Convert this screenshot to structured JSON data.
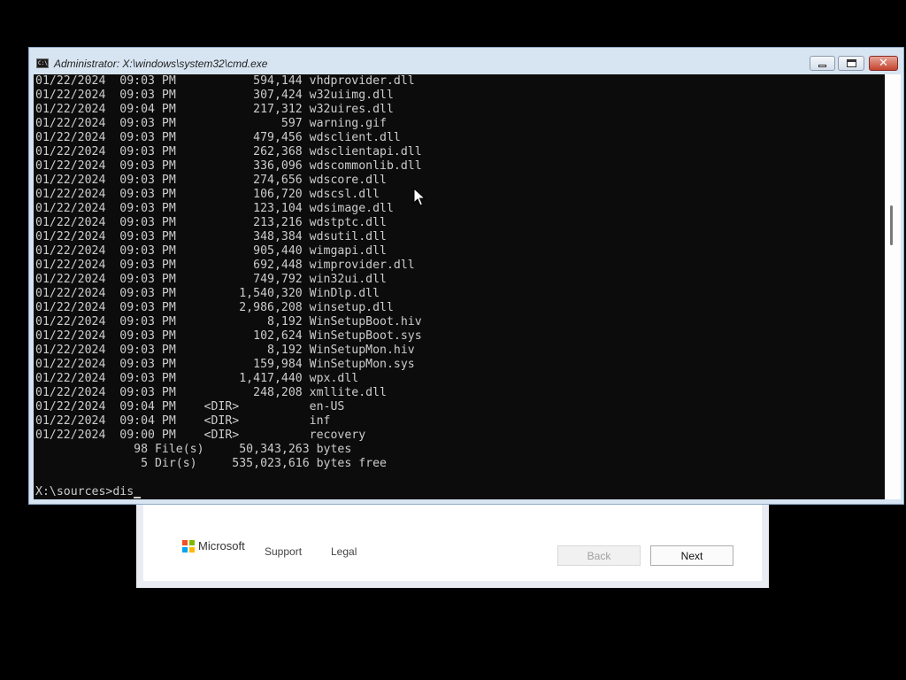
{
  "cmd_window": {
    "title": "Administrator: X:\\windows\\system32\\cmd.exe",
    "icon_text": "C:\\",
    "close_glyph": "✕"
  },
  "console": {
    "lines": [
      "01/22/2024  09:03 PM           594,144 vhdprovider.dll",
      "01/22/2024  09:03 PM           307,424 w32uiimg.dll",
      "01/22/2024  09:04 PM           217,312 w32uires.dll",
      "01/22/2024  09:03 PM               597 warning.gif",
      "01/22/2024  09:03 PM           479,456 wdsclient.dll",
      "01/22/2024  09:03 PM           262,368 wdsclientapi.dll",
      "01/22/2024  09:03 PM           336,096 wdscommonlib.dll",
      "01/22/2024  09:03 PM           274,656 wdscore.dll",
      "01/22/2024  09:03 PM           106,720 wdscsl.dll",
      "01/22/2024  09:03 PM           123,104 wdsimage.dll",
      "01/22/2024  09:03 PM           213,216 wdstptc.dll",
      "01/22/2024  09:03 PM           348,384 wdsutil.dll",
      "01/22/2024  09:03 PM           905,440 wimgapi.dll",
      "01/22/2024  09:03 PM           692,448 wimprovider.dll",
      "01/22/2024  09:03 PM           749,792 win32ui.dll",
      "01/22/2024  09:03 PM         1,540,320 WinDlp.dll",
      "01/22/2024  09:03 PM         2,986,208 winsetup.dll",
      "01/22/2024  09:03 PM             8,192 WinSetupBoot.hiv",
      "01/22/2024  09:03 PM           102,624 WinSetupBoot.sys",
      "01/22/2024  09:03 PM             8,192 WinSetupMon.hiv",
      "01/22/2024  09:03 PM           159,984 WinSetupMon.sys",
      "01/22/2024  09:03 PM         1,417,440 wpx.dll",
      "01/22/2024  09:03 PM           248,208 xmllite.dll",
      "01/22/2024  09:04 PM    <DIR>          en-US",
      "01/22/2024  09:04 PM    <DIR>          inf",
      "01/22/2024  09:00 PM    <DIR>          recovery",
      "              98 File(s)     50,343,263 bytes",
      "               5 Dir(s)     535,023,616 bytes free",
      "",
      "X:\\sources>dis"
    ]
  },
  "setup": {
    "brand": "Microsoft",
    "support_link": "Support",
    "legal_link": "Legal",
    "back_button": "Back",
    "next_button": "Next",
    "logo_colors": [
      "#f25022",
      "#7fba00",
      "#00a4ef",
      "#ffb900"
    ]
  }
}
